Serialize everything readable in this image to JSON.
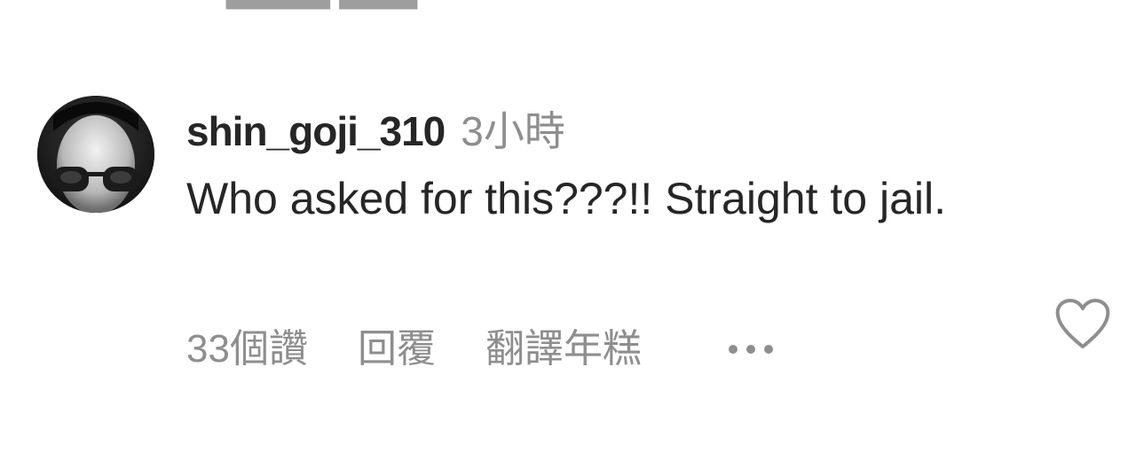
{
  "comment": {
    "username": "shin_goji_310",
    "timestamp": "3小時",
    "text": "Who asked for this???!! Straight to jail.",
    "avatar_icon": "avatar-photo",
    "like_icon": "heart-outline-icon",
    "actions": {
      "likes_label": "33個讚",
      "reply_label": "回覆",
      "translate_label": "翻譯年糕",
      "more_icon": "more-dots-icon"
    }
  },
  "colors": {
    "primary_text": "#262626",
    "secondary_text": "#8e8e8e",
    "background": "#ffffff"
  }
}
